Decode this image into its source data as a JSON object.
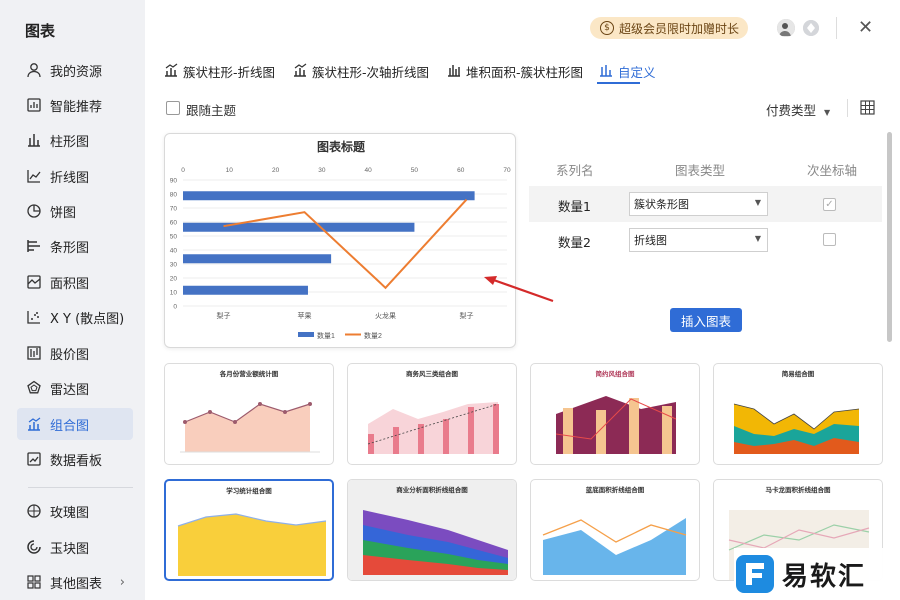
{
  "sidebar": {
    "title": "图表",
    "items": [
      {
        "label": "我的资源",
        "icon": "user-icon"
      },
      {
        "label": "智能推荐",
        "icon": "smart-icon"
      },
      {
        "label": "柱形图",
        "icon": "bar-chart-icon"
      },
      {
        "label": "折线图",
        "icon": "line-chart-icon"
      },
      {
        "label": "饼图",
        "icon": "pie-chart-icon"
      },
      {
        "label": "条形图",
        "icon": "hbar-chart-icon"
      },
      {
        "label": "面积图",
        "icon": "area-chart-icon"
      },
      {
        "label": "X Y (散点图)",
        "icon": "scatter-chart-icon"
      },
      {
        "label": "股价图",
        "icon": "stock-chart-icon"
      },
      {
        "label": "雷达图",
        "icon": "radar-chart-icon"
      },
      {
        "label": "组合图",
        "icon": "combo-chart-icon",
        "active": true
      },
      {
        "label": "数据看板",
        "icon": "dashboard-icon"
      },
      {
        "label": "玫瑰图",
        "icon": "rose-chart-icon"
      },
      {
        "label": "玉块图",
        "icon": "jade-chart-icon"
      },
      {
        "label": "其他图表",
        "icon": "more-chart-icon"
      }
    ]
  },
  "header": {
    "vip_label": "超级会员限时加赠时长",
    "vip_coin": "$"
  },
  "tabs": [
    {
      "label": "簇状柱形-折线图"
    },
    {
      "label": "簇状柱形-次轴折线图"
    },
    {
      "label": "堆积面积-簇状柱形图"
    },
    {
      "label": "自定义",
      "active": true
    }
  ],
  "toolbar": {
    "follow_theme_label": "跟随主题",
    "pay_type_label": "付费类型"
  },
  "preview": {
    "chart_data": {
      "type": "bar+line",
      "title": "图表标题",
      "categories": [
        "梨子",
        "苹果",
        "火龙果",
        "梨子"
      ],
      "x_top_ticks": [
        "0",
        "10",
        "20",
        "30",
        "40",
        "50",
        "60",
        "70"
      ],
      "y_ticks": [
        "0",
        "10",
        "20",
        "30",
        "40",
        "50",
        "60",
        "70",
        "80",
        "90"
      ],
      "series": [
        {
          "name": "数量1",
          "type": "bar",
          "values": [
            63,
            50,
            32,
            27
          ],
          "color": "#4472c4"
        },
        {
          "name": "数量2",
          "type": "line",
          "values": [
            57,
            67,
            13,
            76
          ],
          "color": "#ed7d31"
        }
      ],
      "legend": "bottom"
    }
  },
  "series_panel": {
    "headers": {
      "name": "系列名",
      "type": "图表类型",
      "secondary": "次坐标轴"
    },
    "rows": [
      {
        "name": "数量1",
        "type": "簇状条形图",
        "secondary": true
      },
      {
        "name": "数量2",
        "type": "折线图",
        "secondary": false
      }
    ],
    "insert_label": "插入图表"
  },
  "templates": [
    {
      "title": "各月份营业额统计图"
    },
    {
      "title": "商务风三类组合图"
    },
    {
      "title": "简约风组合图"
    },
    {
      "title": "简易组合图"
    },
    {
      "title": "学习统计组合图"
    },
    {
      "title": "商业分析面积折线组合图"
    },
    {
      "title": "蓝底面积折线组合图"
    },
    {
      "title": "马卡龙面积折线组合图"
    }
  ],
  "watermark": {
    "text": "易软汇"
  }
}
